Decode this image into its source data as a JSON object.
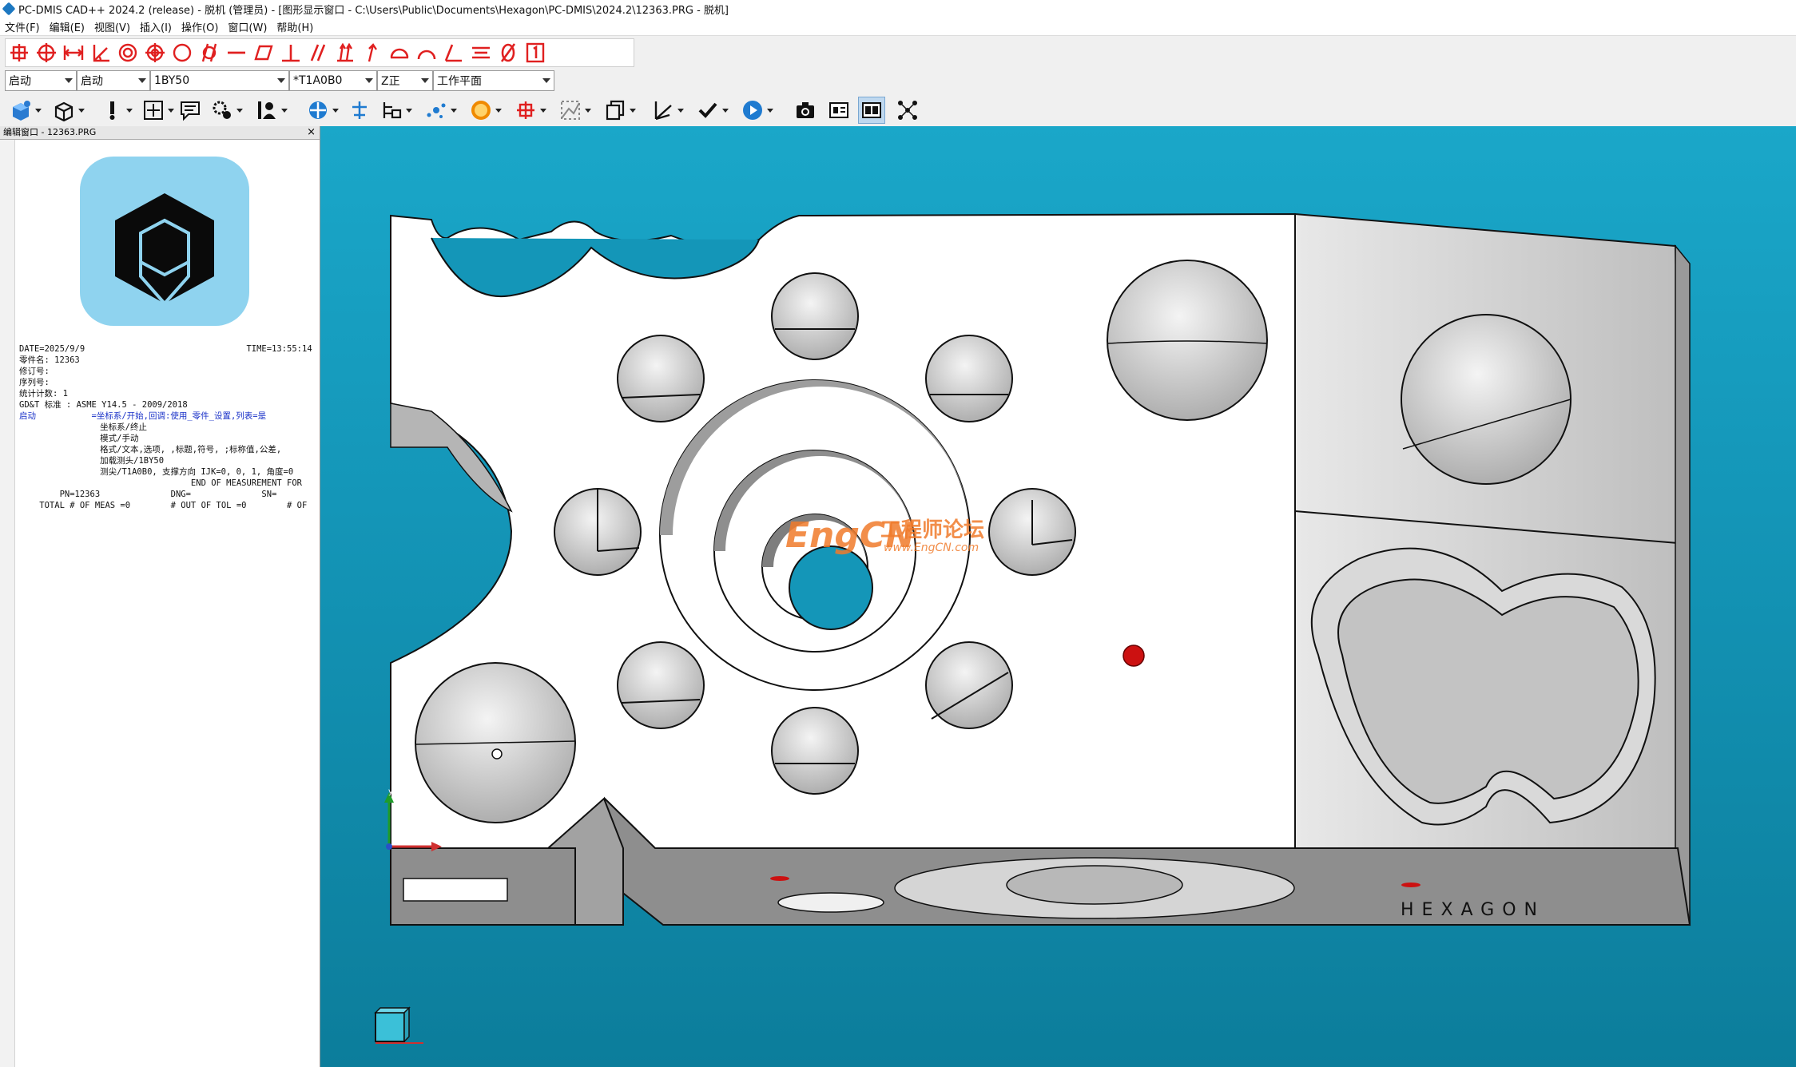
{
  "window": {
    "title": "PC-DMIS CAD++ 2024.2 (release) - 脱机 (管理员) - [图形显示窗口 - C:\\Users\\Public\\Documents\\Hexagon\\PC-DMIS\\2024.2\\12363.PRG - 脱机]"
  },
  "menu": [
    "文件(F)",
    "编辑(E)",
    "视图(V)",
    "插入(I)",
    "操作(O)",
    "窗口(W)",
    "帮助(H)"
  ],
  "toolbar_row1_icons": [
    "point-icon",
    "circle-icon",
    "width-icon",
    "angle-icon",
    "concentric-icon",
    "position-icon",
    "roundness-icon",
    "cylindricity-icon",
    "straightness-icon",
    "flatness-icon",
    "perpendicularity-icon",
    "parallelism-icon",
    "total-runout-icon",
    "circular-runout-icon",
    "profile-line-icon",
    "profile-surface-icon",
    "angularity-icon",
    "symmetry-icon",
    "coaxiality-icon",
    "datum-1-icon"
  ],
  "combos": {
    "align1": "启动",
    "align2": "启动",
    "probe": "1BY50",
    "tip": "*T1A0B0",
    "view": "Z正",
    "workplane": "工作平面"
  },
  "edit_window": {
    "caption": "编辑窗口 - 12363.PRG",
    "close": "×",
    "lines": [
      "DATE=2025/9/9                                TIME=13:55:14",
      "零件名: 12363",
      "修订号:",
      "序列号:",
      "统计计数: 1",
      "GD&T 标准 : ASME Y14.5 - 2009/2018",
      "",
      "启动           =坐标系/开始,回调:使用_零件_设置,列表=是",
      "                坐标系/终止",
      "                模式/手动",
      "                格式/文本,选项, ,标题,符号, ;标称值,公差,",
      "                加载测头/1BY50",
      "                测尖/T1A0B0, 支撑方向 IJK=0, 0, 1, 角度=0",
      "                                  END OF MEASUREMENT FOR",
      "        PN=12363              DNG=              SN=",
      "    TOTAL # OF MEAS =0        # OUT OF TOL =0        # OF"
    ]
  },
  "viewport": {
    "watermark_main": "EngCN",
    "watermark_sub": "工程师论坛",
    "watermark_url": "www.EngCN.com",
    "brand_engraving": "HEXAGON",
    "axis_x": "x",
    "axis_y": "y",
    "colors": {
      "background": "#1496b8",
      "part": "#ffffff",
      "hole": "#cfcfcf",
      "red_point": "#cc1111"
    }
  }
}
